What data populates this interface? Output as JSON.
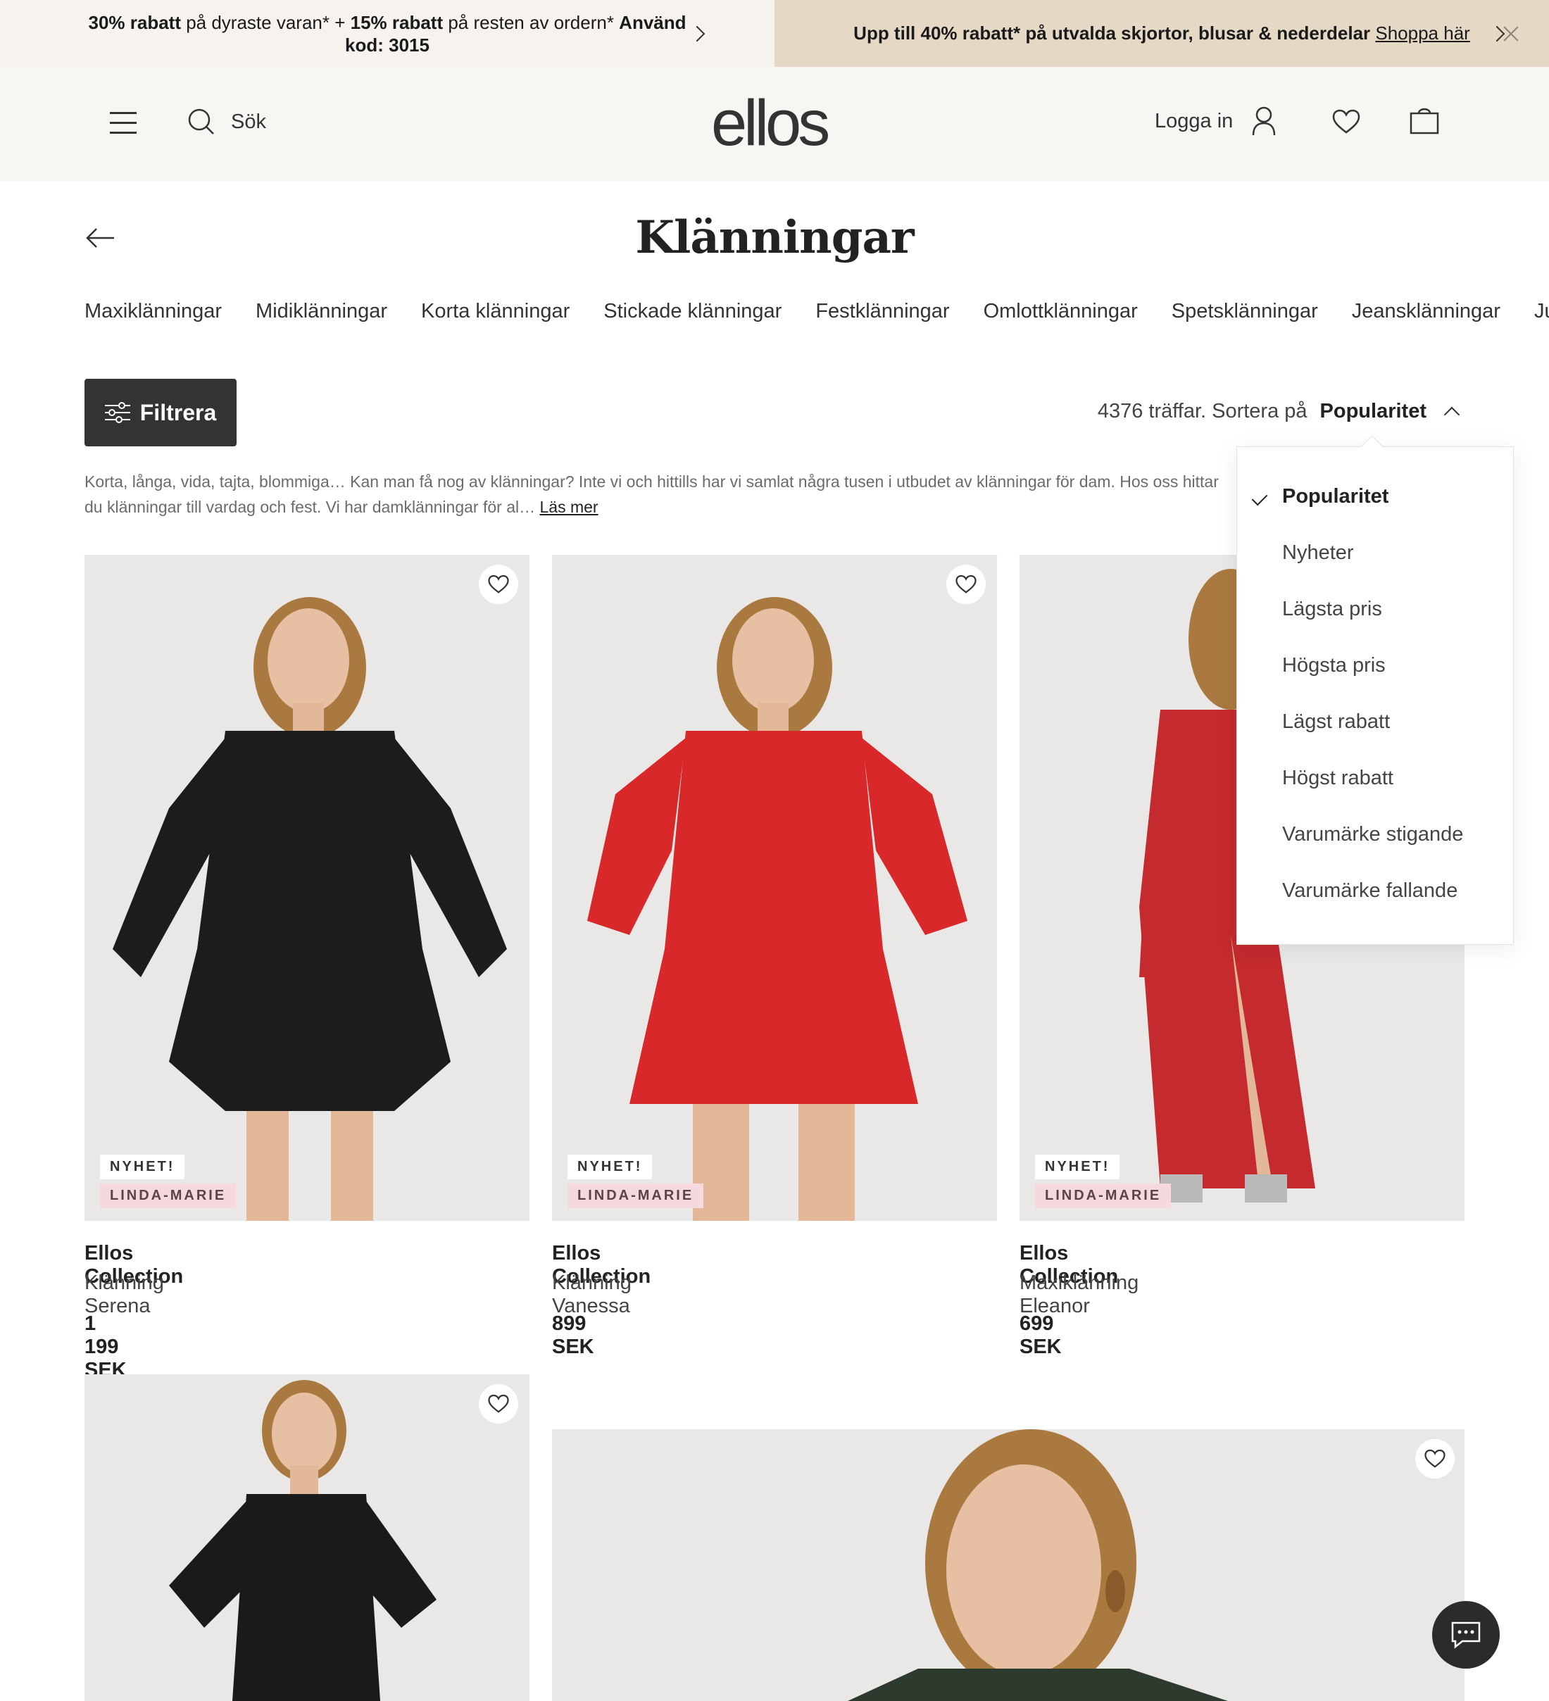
{
  "promo": {
    "left_bold1": "30% rabatt",
    "left_text1": " på dyraste varan* + ",
    "left_bold2": "15% rabatt",
    "left_text2": " på resten av ordern* ",
    "left_bold3": "Använd kod: 3015",
    "right_text": "Upp till 40% rabatt* på utvalda skjortor, blusar & nederdelar ",
    "right_link": "Shoppa här"
  },
  "header": {
    "search_label": "Sök",
    "logo": "ellos",
    "login_label": "Logga in"
  },
  "page": {
    "title": "Klänningar",
    "categories": [
      "Maxiklänningar",
      "Midiklänningar",
      "Korta klänningar",
      "Stickade klänningar",
      "Festklänningar",
      "Omlottklänningar",
      "Spetsklänningar",
      "Jeansklänningar",
      "Ju"
    ],
    "filter_label": "Filtrera",
    "results_text": "4376 träffar. Sortera på",
    "sort_selected": "Popularitet",
    "intro_text": "Korta, långa, vida, tajta, blommiga… Kan man få nog av klänningar? Inte vi och hittills har vi samlat några tusen i utbudet av klänningar för dam. Hos oss hittar du klänningar till vardag och fest. Vi har damklänningar för al… ",
    "read_more": "Läs mer"
  },
  "sort_options": [
    "Popularitet",
    "Nyheter",
    "Lägsta pris",
    "Högsta pris",
    "Lägst rabatt",
    "Högst rabatt",
    "Varumärke stigande",
    "Varumärke fallande"
  ],
  "products": [
    {
      "badge_new": "NYHET!",
      "badge_brand": "LINDA-MARIE",
      "brand": "Ellos Collection",
      "name": "Klänning Serena",
      "price": "1 199 SEK",
      "dress_color": "#1c1c1c"
    },
    {
      "badge_new": "NYHET!",
      "badge_brand": "LINDA-MARIE",
      "brand": "Ellos Collection",
      "name": "Klänning Vanessa",
      "price": "899 SEK",
      "dress_color": "#d8282a"
    },
    {
      "badge_new": "NYHET!",
      "badge_brand": "LINDA-MARIE",
      "brand": "Ellos Collection",
      "name": "Maxiklänning Eleanor",
      "price": "699 SEK",
      "dress_color": "#c42a2e"
    }
  ],
  "icons": [
    "menu-icon",
    "search-icon",
    "user-icon",
    "heart-icon",
    "bag-icon",
    "arrow-left-icon",
    "sliders-icon",
    "chevron-up-icon",
    "check-icon",
    "chat-icon"
  ]
}
